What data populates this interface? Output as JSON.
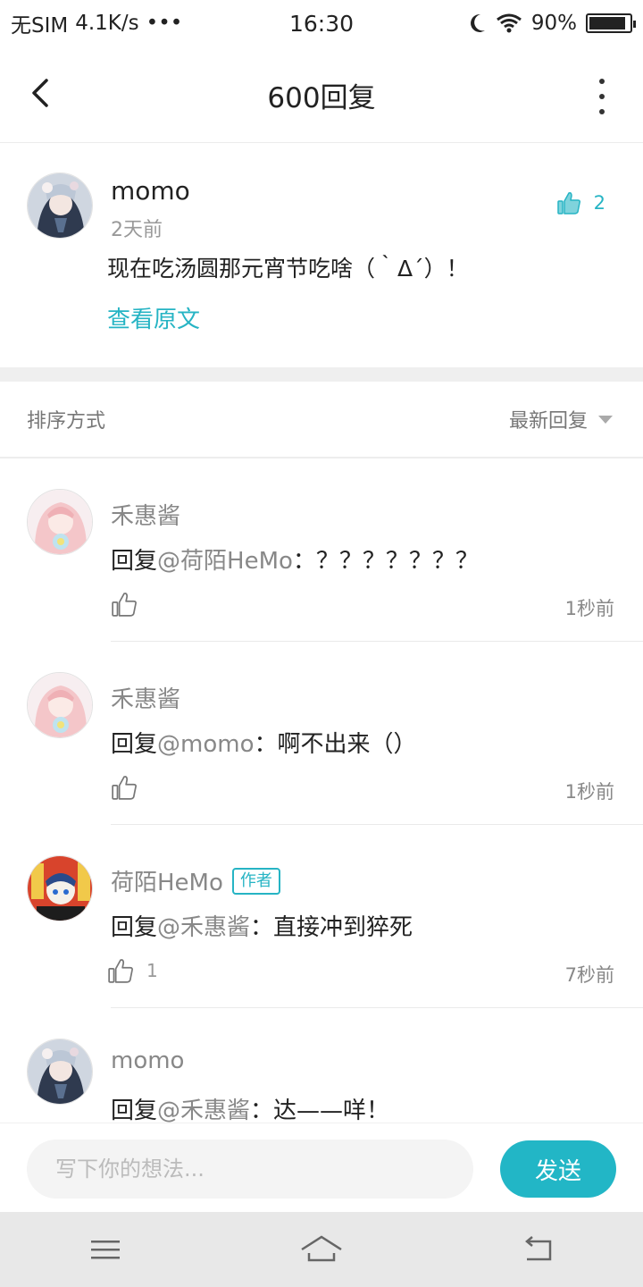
{
  "status_bar": {
    "carrier": "无SIM",
    "speed": "4.1K/s",
    "dots": "•••",
    "time": "16:30",
    "battery": "90%",
    "battery_level": 0.9
  },
  "header": {
    "title": "600回复"
  },
  "original_post": {
    "author": "momo",
    "time": "2天前",
    "text": "现在吃汤圆那元宵节吃啥（｀Δ´）！",
    "view_original": "查看原文",
    "likes": "2"
  },
  "sort": {
    "label": "排序方式",
    "value": "最新回复"
  },
  "replies": [
    {
      "author": "禾惠酱",
      "prefix": "回复",
      "mention": "@荷陌HeMo",
      "body": "：？？？？？？？",
      "likes": "",
      "time": "1秒前",
      "is_author": false
    },
    {
      "author": "禾惠酱",
      "prefix": "回复",
      "mention": "@momo",
      "body": "：啊不出来（）",
      "likes": "",
      "time": "1秒前",
      "is_author": false
    },
    {
      "author": "荷陌HeMo",
      "badge": "作者",
      "prefix": "回复",
      "mention": "@禾惠酱",
      "body": "：直接冲到猝死",
      "likes": "1",
      "time": "7秒前",
      "is_author": true
    },
    {
      "author": "momo",
      "prefix": "回复",
      "mention": "@禾惠酱",
      "body": "：达——咩！",
      "likes": "",
      "time": "",
      "is_author": false
    }
  ],
  "composer": {
    "placeholder": "写下你的想法...",
    "send_label": "发送"
  },
  "colors": {
    "accent": "#22b6c6",
    "link": "#26b4c4"
  }
}
